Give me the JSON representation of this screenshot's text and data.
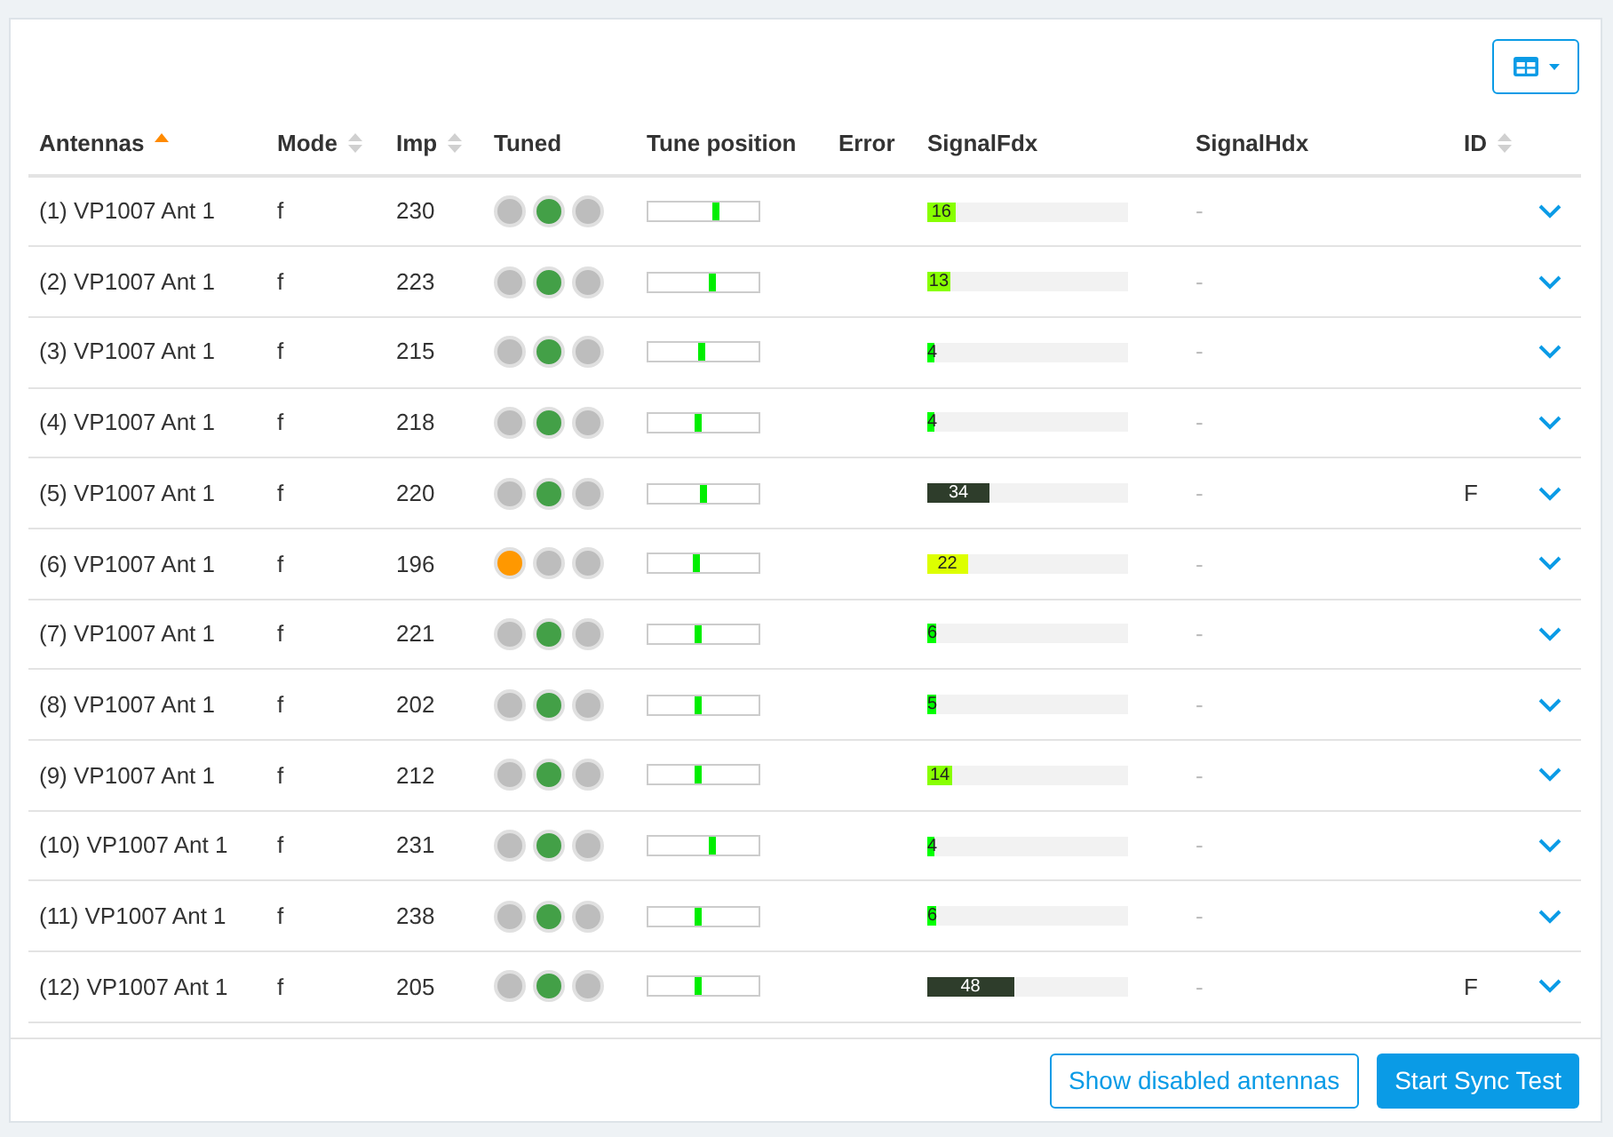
{
  "columns": [
    {
      "label": "Antennas",
      "sortable": true,
      "sorted": true
    },
    {
      "label": "Mode",
      "sortable": true,
      "sorted": false
    },
    {
      "label": "Imp",
      "sortable": true,
      "sorted": false
    },
    {
      "label": "Tuned",
      "sortable": false,
      "sorted": false
    },
    {
      "label": "Tune position",
      "sortable": false,
      "sorted": false
    },
    {
      "label": "Error",
      "sortable": false,
      "sorted": false
    },
    {
      "label": "SignalFdx",
      "sortable": false,
      "sorted": false
    },
    {
      "label": "SignalHdx",
      "sortable": false,
      "sorted": false
    },
    {
      "label": "ID",
      "sortable": true,
      "sorted": false
    }
  ],
  "rows": [
    {
      "antenna": "(1) VP1007 Ant 1",
      "mode": "f",
      "imp": "230",
      "lamps": [
        {
          "color": "#bdbdbd"
        },
        {
          "color": "#43a047"
        },
        {
          "color": "#bdbdbd"
        }
      ],
      "tune": {
        "level": 0.6
      },
      "signal_fdx": {
        "value": "16",
        "level": 0.14,
        "color": "#88ff00"
      },
      "signal_hdx": "-"
    },
    {
      "antenna": "(2) VP1007 Ant 1",
      "mode": "f",
      "imp": "223",
      "lamps": [
        {
          "color": "#bdbdbd"
        },
        {
          "color": "#43a047"
        },
        {
          "color": "#bdbdbd"
        }
      ],
      "tune": {
        "level": 0.57
      },
      "signal_fdx": {
        "value": "13",
        "level": 0.115,
        "color": "#88ff00"
      },
      "signal_hdx": "-"
    },
    {
      "antenna": "(3) VP1007 Ant 1",
      "mode": "f",
      "imp": "215",
      "lamps": [
        {
          "color": "#bdbdbd"
        },
        {
          "color": "#43a047"
        },
        {
          "color": "#bdbdbd"
        }
      ],
      "tune": {
        "level": 0.46
      },
      "signal_fdx": {
        "value": "4",
        "level": 0.035,
        "color": "#00ff00"
      },
      "signal_hdx": "-"
    },
    {
      "antenna": "(4) VP1007 Ant 1",
      "mode": "f",
      "imp": "218",
      "lamps": [
        {
          "color": "#bdbdbd"
        },
        {
          "color": "#43a047"
        },
        {
          "color": "#bdbdbd"
        }
      ],
      "tune": {
        "level": 0.43
      },
      "signal_fdx": {
        "value": "4",
        "level": 0.035,
        "color": "#00ff00"
      },
      "signal_hdx": "-"
    },
    {
      "antenna": "(5) VP1007 Ant 1",
      "mode": "f",
      "imp": "220",
      "lamps": [
        {
          "color": "#bdbdbd"
        },
        {
          "color": "#43a047"
        },
        {
          "color": "#bdbdbd"
        }
      ],
      "tune": {
        "level": 0.49
      },
      "signal_fdx": {
        "value": "34",
        "level": 0.31,
        "color": "#2e3d2b"
      },
      "signal_hdx": "-",
      "id": "F"
    },
    {
      "antenna": "(6) VP1007 Ant 1",
      "mode": "f",
      "imp": "196",
      "lamps": [
        {
          "color": "#ff9800"
        },
        {
          "color": "#bdbdbd"
        },
        {
          "color": "#bdbdbd"
        }
      ],
      "tune": {
        "level": 0.41
      },
      "signal_fdx": {
        "value": "22",
        "level": 0.2,
        "color": "#ddff00"
      },
      "signal_hdx": "-"
    },
    {
      "antenna": "(7) VP1007 Ant 1",
      "mode": "f",
      "imp": "221",
      "lamps": [
        {
          "color": "#bdbdbd"
        },
        {
          "color": "#43a047"
        },
        {
          "color": "#bdbdbd"
        }
      ],
      "tune": {
        "level": 0.44
      },
      "signal_fdx": {
        "value": "6",
        "level": 0.045,
        "color": "#00ff00"
      },
      "signal_hdx": "-"
    },
    {
      "antenna": "(8) VP1007 Ant 1",
      "mode": "f",
      "imp": "202",
      "lamps": [
        {
          "color": "#bdbdbd"
        },
        {
          "color": "#43a047"
        },
        {
          "color": "#bdbdbd"
        }
      ],
      "tune": {
        "level": 0.44
      },
      "signal_fdx": {
        "value": "5",
        "level": 0.04,
        "color": "#00ff00"
      },
      "signal_hdx": "-"
    },
    {
      "antenna": "(9) VP1007 Ant 1",
      "mode": "f",
      "imp": "212",
      "lamps": [
        {
          "color": "#bdbdbd"
        },
        {
          "color": "#43a047"
        },
        {
          "color": "#bdbdbd"
        }
      ],
      "tune": {
        "level": 0.43
      },
      "signal_fdx": {
        "value": "14",
        "level": 0.125,
        "color": "#88ff00"
      },
      "signal_hdx": "-"
    },
    {
      "antenna": "(10) VP1007 Ant 1",
      "mode": "f",
      "imp": "231",
      "lamps": [
        {
          "color": "#bdbdbd"
        },
        {
          "color": "#43a047"
        },
        {
          "color": "#bdbdbd"
        }
      ],
      "tune": {
        "level": 0.56
      },
      "signal_fdx": {
        "value": "4",
        "level": 0.035,
        "color": "#00ff00"
      },
      "signal_hdx": "-"
    },
    {
      "antenna": "(11) VP1007 Ant 1",
      "mode": "f",
      "imp": "238",
      "lamps": [
        {
          "color": "#bdbdbd"
        },
        {
          "color": "#43a047"
        },
        {
          "color": "#bdbdbd"
        }
      ],
      "tune": {
        "level": 0.44
      },
      "signal_fdx": {
        "value": "6",
        "level": 0.045,
        "color": "#00ff00"
      },
      "signal_hdx": "-"
    },
    {
      "antenna": "(12) VP1007 Ant 1",
      "mode": "f",
      "imp": "205",
      "lamps": [
        {
          "color": "#bdbdbd"
        },
        {
          "color": "#43a047"
        },
        {
          "color": "#bdbdbd"
        }
      ],
      "tune": {
        "level": 0.44
      },
      "signal_fdx": {
        "value": "48",
        "level": 0.43,
        "color": "#2e3d2b"
      },
      "signal_hdx": "-",
      "id": "F"
    }
  ],
  "footer_buttons": [
    {
      "label": "Show disabled antennas",
      "kind": "outline"
    },
    {
      "label": "Start Sync Test",
      "kind": "primary"
    }
  ]
}
